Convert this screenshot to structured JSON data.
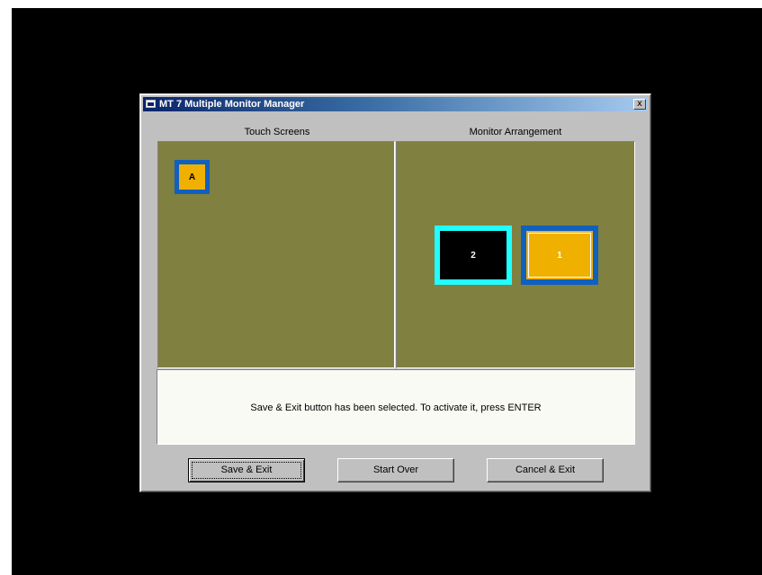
{
  "window": {
    "title": "MT 7 Multiple Monitor Manager",
    "close_label": "x"
  },
  "sections": {
    "touch_screens_label": "Touch Screens",
    "monitor_arrangement_label": "Monitor Arrangement"
  },
  "touch_screens": [
    {
      "label": "A",
      "color": "#f0b000",
      "border_color": "#1060c0"
    }
  ],
  "monitors": [
    {
      "label": "2",
      "color": "#000000",
      "border_color": "#20ffff"
    },
    {
      "label": "1",
      "color": "#f0b000",
      "border_color": "#1060c0"
    }
  ],
  "message": "Save & Exit button has been selected. To activate it, press ENTER",
  "buttons": {
    "save_exit": "Save & Exit",
    "start_over": "Start Over",
    "cancel_exit": "Cancel & Exit"
  },
  "colors": {
    "panel_background": "#808040",
    "titlebar_start": "#0a246a",
    "titlebar_end": "#a6caf0",
    "dialog_face": "#c0c0c0"
  }
}
